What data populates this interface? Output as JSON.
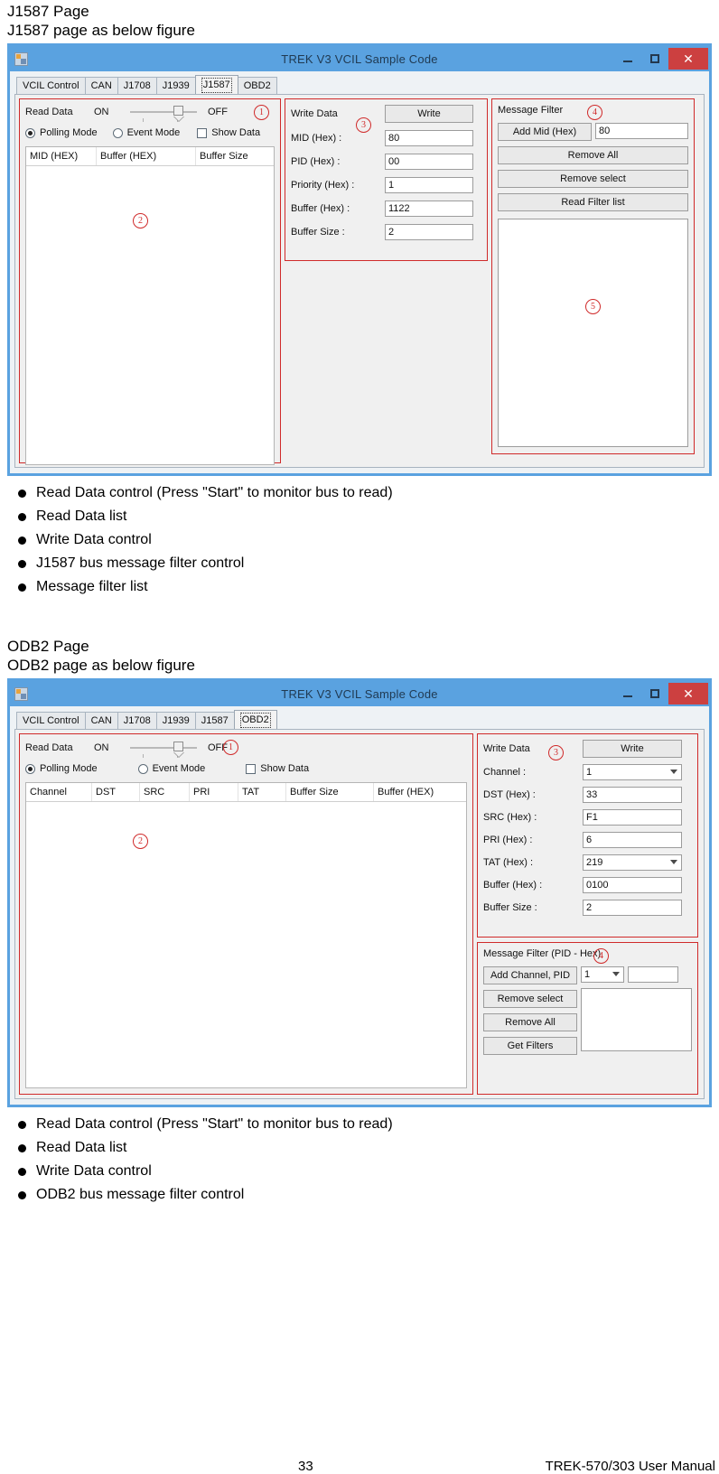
{
  "page": {
    "number": "33",
    "manual": "TREK-570/303 User Manual"
  },
  "sections": [
    {
      "heading": "J1587 Page",
      "subheading": "J1587 page as below figure",
      "bullets": [
        "Read Data control (Press \"Start\" to monitor bus to read)",
        "Read Data list",
        "Write Data control",
        "J1587 bus message filter control",
        "Message filter list"
      ]
    },
    {
      "heading": "ODB2 Page",
      "subheading": "ODB2 page as below figure",
      "bullets": [
        "Read Data control (Press \"Start\" to monitor bus to read)",
        "Read Data list",
        "Write Data control",
        "ODB2 bus message filter control"
      ]
    }
  ],
  "window": {
    "title": "TREK V3 VCIL Sample Code",
    "icon": "app-icon",
    "buttons": {
      "minimize": "–",
      "maximize": "□",
      "close": "✕"
    },
    "tabs": [
      "VCIL Control",
      "CAN",
      "J1708",
      "J1939",
      "J1587",
      "OBD2"
    ]
  },
  "colors": {
    "title_bar": "#5aa2e0",
    "close_button": "#cc4040",
    "annotation": "#d02a2a",
    "panel": "#f0f0f0"
  },
  "j1587": {
    "selected_tab": "J1587",
    "read_data": {
      "label": "Read Data",
      "on_label": "ON",
      "off_label": "OFF",
      "marker": "1",
      "polling_mode": "Polling Mode",
      "event_mode": "Event Mode",
      "show_data": "Show Data",
      "polling_selected": true,
      "show_data_checked": false
    },
    "read_list": {
      "marker": "2",
      "columns": [
        "MID (HEX)",
        "Buffer (HEX)",
        "Buffer Size"
      ],
      "rows": []
    },
    "write_data": {
      "title": "Write Data",
      "marker": "3",
      "write_button": "Write",
      "fields": [
        {
          "label": "MID (Hex) :",
          "value": "80"
        },
        {
          "label": "PID (Hex) :",
          "value": "00"
        },
        {
          "label": "Priority (Hex) :",
          "value": "1"
        },
        {
          "label": "Buffer (Hex) :",
          "value": "1122"
        },
        {
          "label": "Buffer Size :",
          "value": "2"
        }
      ]
    },
    "message_filter": {
      "title": "Message Filter",
      "marker": "4",
      "add_button": "Add Mid (Hex)",
      "add_value": "80",
      "buttons": [
        "Remove All",
        "Remove select",
        "Read Filter list"
      ],
      "list_marker": "5",
      "list_items": []
    }
  },
  "obd2": {
    "selected_tab": "OBD2",
    "read_data": {
      "label": "Read Data",
      "on_label": "ON",
      "off_label": "OFF",
      "marker": "1",
      "polling_mode": "Polling Mode",
      "event_mode": "Event Mode",
      "show_data": "Show Data",
      "polling_selected": true,
      "show_data_checked": false
    },
    "read_list": {
      "marker": "2",
      "columns": [
        "Channel",
        "DST",
        "SRC",
        "PRI",
        "TAT",
        "Buffer Size",
        "Buffer (HEX)"
      ],
      "rows": []
    },
    "write_data": {
      "title": "Write Data",
      "marker": "3",
      "write_button": "Write",
      "fields": [
        {
          "label": "Channel :",
          "value": "1",
          "type": "select"
        },
        {
          "label": "DST (Hex) :",
          "value": "33",
          "type": "text"
        },
        {
          "label": "SRC (Hex) :",
          "value": "F1",
          "type": "text"
        },
        {
          "label": "PRI (Hex) :",
          "value": "6",
          "type": "text"
        },
        {
          "label": "TAT (Hex) :",
          "value": "219",
          "type": "select"
        },
        {
          "label": "Buffer (Hex) :",
          "value": "0100",
          "type": "text"
        },
        {
          "label": "Buffer Size :",
          "value": "2",
          "type": "text"
        }
      ]
    },
    "message_filter": {
      "title": "Message Filter (PID - Hex)",
      "marker": "4",
      "add_button": "Add Channel, PID",
      "channel_value": "1",
      "pid_value": "",
      "buttons": [
        "Remove select",
        "Remove All",
        "Get Filters"
      ],
      "list_items": []
    }
  }
}
